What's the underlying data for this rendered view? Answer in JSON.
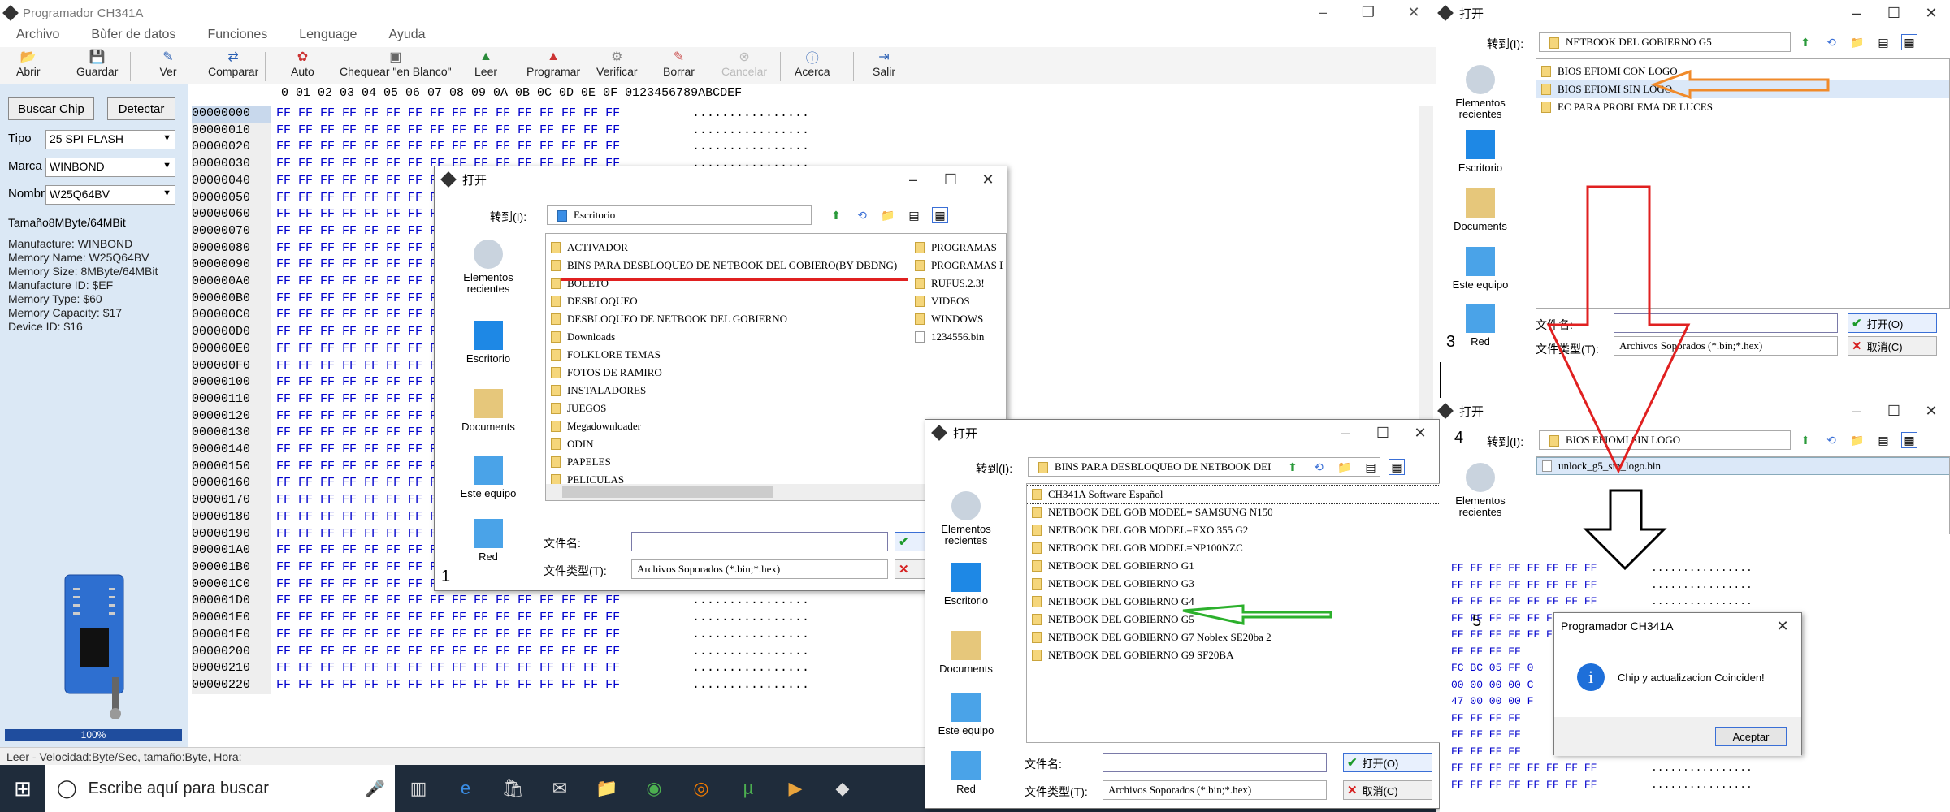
{
  "app": {
    "title": "Programador CH341A",
    "menu": [
      "Archivo",
      "Bùfer de datos",
      "Funciones",
      "Lenguage",
      "Ayuda"
    ],
    "toolbar": {
      "abrir": "Abrir",
      "guardar": "Guardar",
      "ver": "Ver",
      "comparar": "Comparar",
      "auto": "Auto",
      "chequear": "Chequear \"en Blanco\"",
      "leer": "Leer",
      "programar": "Programar",
      "verificar": "Verificar",
      "borrar": "Borrar",
      "cancelar": "Cancelar",
      "acerca": "Acerca",
      "salir": "Salir"
    },
    "left": {
      "buscar": "Buscar Chip",
      "detectar": "Detectar",
      "tipo_label": "Tipo",
      "tipo_value": "25 SPI FLASH",
      "marca_label": "Marca",
      "marca_value": "WINBOND",
      "nombre_label": "Nombre",
      "nombre_value": "W25Q64BV",
      "tamano": "Tamaño8MByte/64MBit",
      "info": [
        "Manufacture: WINBOND",
        "Memory Name: W25Q64BV",
        "Memory Size: 8MByte/64MBit",
        "Manufacture ID: $EF",
        "Memory Type: $60",
        "Memory Capacity: $17",
        "Device ID: $16"
      ],
      "progress": "100%",
      "progress_value": 1.0
    },
    "hex": {
      "header": "0 01 02 03 04 05 06 07 08 09 0A 0B 0C 0D 0E 0F   0123456789ABCDEF",
      "addresses": [
        "00000000",
        "00000010",
        "00000020",
        "00000030",
        "00000040",
        "00000050",
        "00000060",
        "00000070",
        "00000080",
        "00000090",
        "000000A0",
        "000000B0",
        "000000C0",
        "000000D0",
        "000000E0",
        "000000F0",
        "00000100",
        "00000110",
        "00000120",
        "00000130",
        "00000140",
        "00000150",
        "00000160",
        "00000170",
        "00000180",
        "00000190",
        "000001A0",
        "000001B0",
        "000001C0",
        "000001D0",
        "000001E0",
        "000001F0",
        "00000200",
        "00000210",
        "00000220"
      ],
      "row": "FF FF FF FF FF FF FF FF FF FF FF FF FF FF FF FF",
      "ascii": "................"
    },
    "status": "Leer - Velocidad:Byte/Sec, tamaño:Byte, Hora:",
    "taskbar_search": "Escribe aquí para buscar"
  },
  "common": {
    "dialog_title": "打开",
    "goto": "转到(I):",
    "filename": "文件名:",
    "filetype": "文件类型(T):",
    "filetype_value": "Archivos Soporados (*.bin;*.hex)",
    "open": "打开(O)",
    "cancel": "取消(C)",
    "sidebar": [
      "Elementos recientes",
      "Escritorio",
      "Documents",
      "Este equipo",
      "Red"
    ]
  },
  "dialog1": {
    "path": "Escritorio",
    "number": "1",
    "files_left": [
      "ACTIVADOR",
      "BINS PARA DESBLOQUEO DE NETBOOK DEL GOBIERO(BY DBDNG)",
      "BOLETO",
      "DESBLOQUEO",
      "DESBLOQUEO DE NETBOOK DEL GOBIERNO",
      "Downloads",
      "FOLKLORE TEMAS",
      "FOTOS DE RAMIRO",
      "INSTALADORES",
      "JUEGOS",
      "Megadownloader",
      "ODIN",
      "PAPELES",
      "PELICULAS"
    ],
    "files_right": [
      "PROGRAMAS",
      "PROGRAMAS I",
      "RUFUS.2.3!",
      "VIDEOS",
      "WINDOWS",
      "1234556.bin"
    ]
  },
  "dialog2": {
    "path": "BINS PARA DESBLOQUEO DE NETBOOK DEI",
    "files": [
      "CH341A Software Español",
      "NETBOOK DEL GOB MODEL= SAMSUNG N150",
      "NETBOOK DEL GOB MODEL=EXO 355 G2",
      "NETBOOK DEL GOB MODEL=NP100NZC",
      "NETBOOK DEL GOBIERNO G1",
      "NETBOOK DEL GOBIERNO G3",
      "NETBOOK DEL GOBIERNO G4",
      "NETBOOK DEL GOBIERNO G5",
      "NETBOOK DEL GOBIERNO G7 Noblex SE20ba 2",
      "NETBOOK DEL GOBIERNO G9 SF20BA"
    ]
  },
  "dialog3": {
    "path": "NETBOOK DEL GOBIERNO G5",
    "number": "3",
    "files": [
      "BIOS EFIOMI CON LOGO",
      "BIOS EFIOMI SIN LOGO",
      "EC PARA PROBLEMA DE LUCES"
    ]
  },
  "dialog4": {
    "path": "BIOS EFIOMI SIN LOGO",
    "number": "4",
    "files": [
      "unlock_g5_sin_logo.bin"
    ]
  },
  "panel5": {
    "number": "5",
    "rows": [
      "FF FF FF FF FF FF FF FF",
      "FF FF FF FF FF FF FF FF",
      "FF FF FF FF FF FF FF FF",
      "FF FF FF FF FF FF FF FF",
      "FF FF FF FF FF FF FF FF",
      "FF FF FF FF",
      "FC BC 05 FF 0",
      "00 00 00 00 C",
      "47 00 00 00 F",
      "FF FF FF FF",
      "FF FF FF FF",
      "FF FF FF FF",
      "FF FF FF FF FF FF FF FF",
      "FF FF FF FF FF FF FF FF"
    ],
    "msg_title": "Programador CH341A",
    "msg_text": "Chip y actualizacion Coinciden!",
    "msg_ok": "Aceptar"
  },
  "colors": {
    "red": "#e02020",
    "orange": "#f08a2a",
    "green": "#2cb02c",
    "black": "#000000"
  }
}
